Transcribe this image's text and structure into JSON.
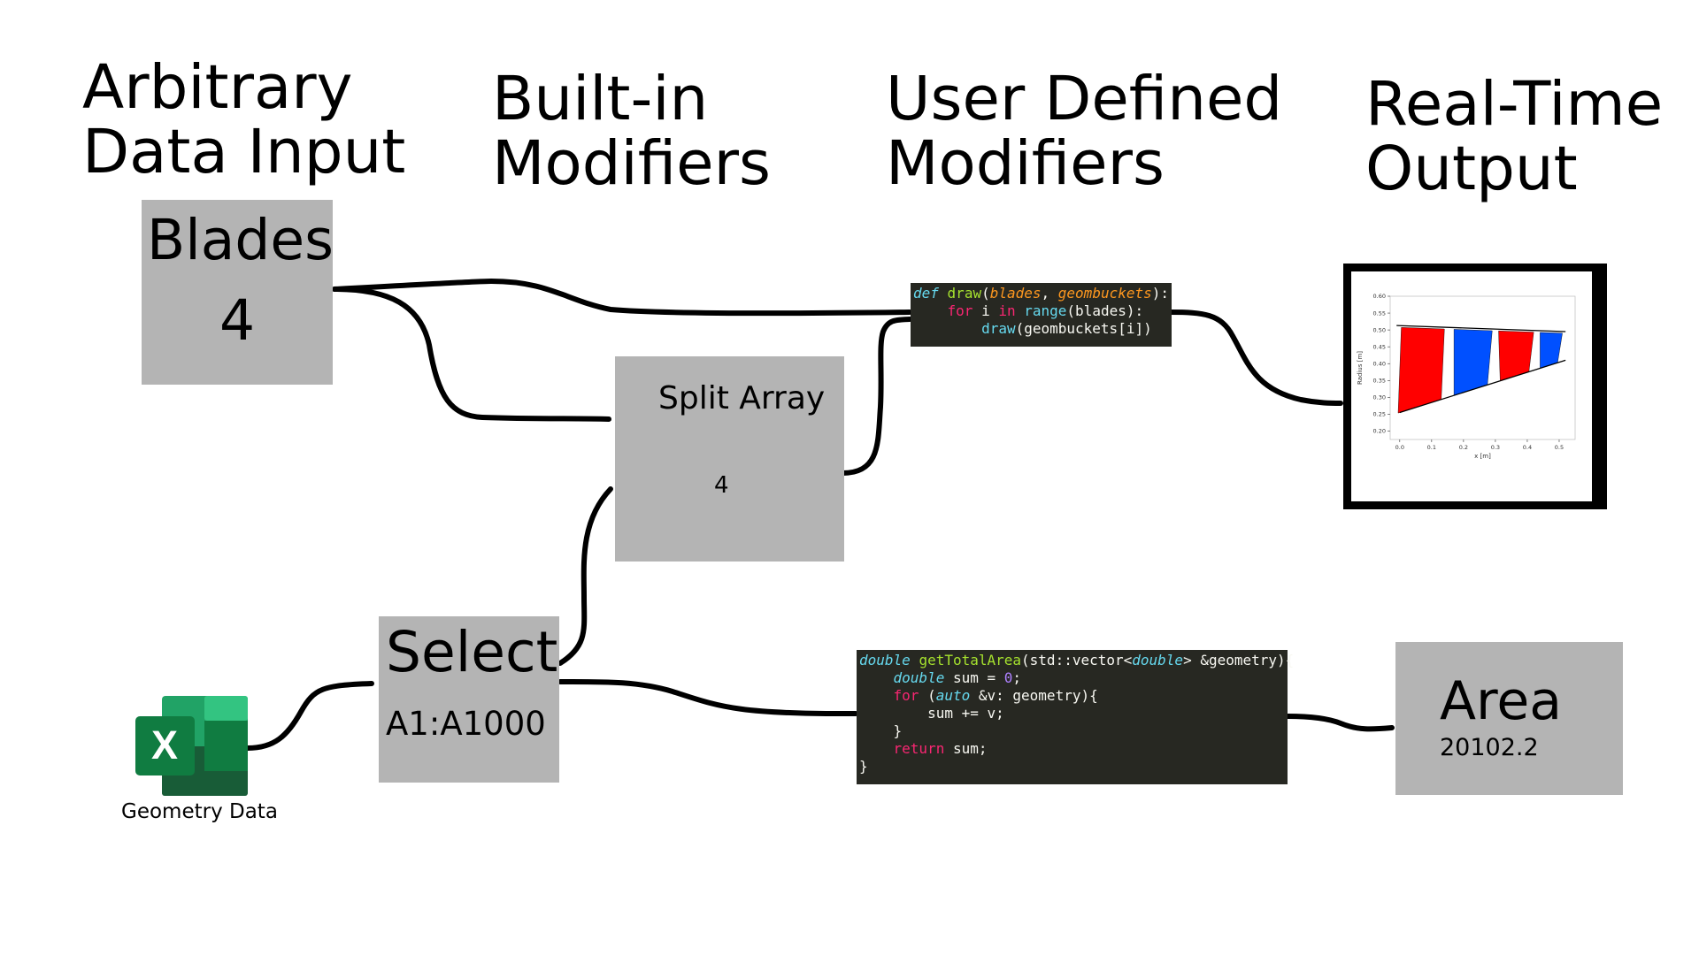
{
  "headings": {
    "input": "Arbitrary\nData Input",
    "builtin": "Built-in\nModifiers",
    "user": "User Defined\nModifiers",
    "output": "Real-Time\nOutput"
  },
  "nodes": {
    "blades": {
      "title": "Blades",
      "value": "4"
    },
    "split": {
      "title": "Split Array",
      "value": "4"
    },
    "select": {
      "title": "Select",
      "value": "A1:A1000"
    },
    "area": {
      "title": "Area",
      "value": "20102.2"
    }
  },
  "excel": {
    "label": "Geometry Data",
    "letter": "X"
  },
  "code_draw": [
    "def draw(blades, geombuckets):",
    "    for i in range(blades):",
    "        draw(geombuckets[i])"
  ],
  "code_area": [
    "double getTotalArea(std::vector<double> &geometry){",
    "    double sum = 0;",
    "    for (auto &v: geometry){",
    "        sum += v;",
    "    }",
    "    return sum;",
    "}"
  ],
  "chart_data": {
    "type": "area",
    "xlabel": "x [m]",
    "ylabel": "Radius [m]",
    "xlim": [
      -0.03,
      0.55
    ],
    "ylim": [
      0.175,
      0.6
    ],
    "x_ticks": [
      "0.0",
      "0.1",
      "0.2",
      "0.3",
      "0.4",
      "0.5"
    ],
    "x_tick_values": [
      0.0,
      0.1,
      0.2,
      0.3,
      0.4,
      0.5
    ],
    "y_ticks": [
      "0.20",
      "0.25",
      "0.30",
      "0.35",
      "0.40",
      "0.45",
      "0.50",
      "0.55",
      "0.60"
    ],
    "y_tick_values": [
      0.2,
      0.25,
      0.3,
      0.35,
      0.4,
      0.45,
      0.5,
      0.55,
      0.6
    ],
    "hub_line": {
      "x": [
        0.0,
        0.52
      ],
      "y": [
        0.255,
        0.41
      ]
    },
    "tip_line": {
      "x": [
        -0.01,
        0.52
      ],
      "y": [
        0.513,
        0.495
      ]
    },
    "blades": [
      {
        "color": "#ff0000",
        "x_left_top": 0.005,
        "x_right_top": 0.14,
        "x_left_bot": -0.005,
        "x_right_bot": 0.13
      },
      {
        "color": "#0050ff",
        "x_left_top": 0.17,
        "x_right_top": 0.29,
        "x_left_bot": 0.17,
        "x_right_bot": 0.275
      },
      {
        "color": "#ff0000",
        "x_left_top": 0.31,
        "x_right_top": 0.42,
        "x_left_bot": 0.315,
        "x_right_bot": 0.405
      },
      {
        "color": "#0050ff",
        "x_left_top": 0.44,
        "x_right_top": 0.51,
        "x_left_bot": 0.44,
        "x_right_bot": 0.495
      }
    ]
  }
}
